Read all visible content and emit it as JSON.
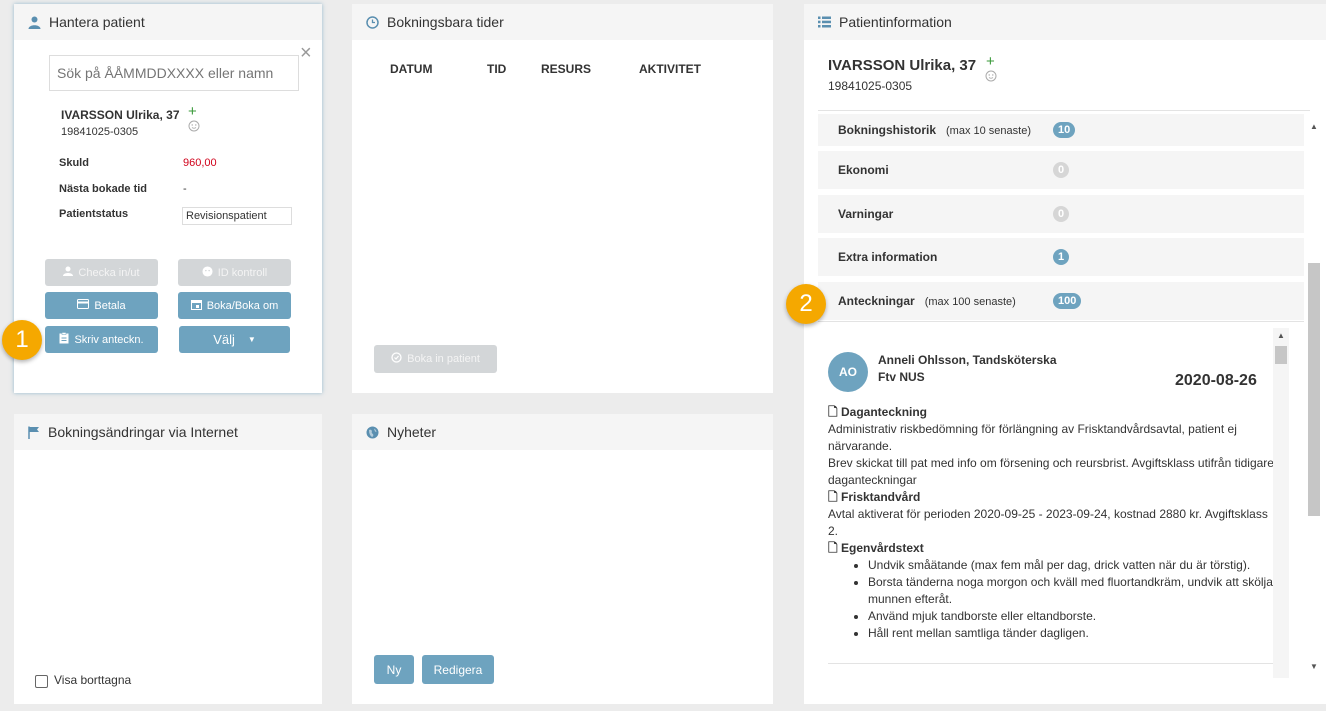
{
  "hantera": {
    "title": "Hantera patient",
    "search_placeholder": "Sök på ÅÅMMDDXXXX eller namn",
    "patient_name": "IVARSSON Ulrika, 37",
    "patient_id": "19841025-0305",
    "fields": [
      {
        "label": "Skuld",
        "value": "960,00"
      },
      {
        "label": "Nästa bokade tid",
        "value": "-"
      },
      {
        "label": "Patientstatus",
        "value": "Revisionspatient"
      }
    ],
    "buttons": {
      "checka": "Checka in/ut",
      "id_kontroll": "ID kontroll",
      "betala": "Betala",
      "boka": "Boka/Boka om",
      "skriv": "Skriv anteckn.",
      "valj": "Välj"
    }
  },
  "bokningsbara": {
    "title": "Bokningsbara tider",
    "columns": [
      "DATUM",
      "TID",
      "RESURS",
      "AKTIVITET"
    ],
    "boka_in_label": "Boka in patient"
  },
  "internet": {
    "title": "Bokningsändringar via Internet",
    "visa_borttagna": "Visa borttagna"
  },
  "nyheter": {
    "title": "Nyheter",
    "ny": "Ny",
    "redigera": "Redigera"
  },
  "patientinfo": {
    "title": "Patientinformation",
    "patient_name": "IVARSSON Ulrika, 37",
    "patient_id": "19841025-0305",
    "rows": [
      {
        "label": "Bokningshistorik",
        "sub": "(max 10 senaste)",
        "count": "10"
      },
      {
        "label": "Ekonomi",
        "sub": "",
        "count": "0"
      },
      {
        "label": "Varningar",
        "sub": "",
        "count": "0"
      },
      {
        "label": "Extra information",
        "sub": "",
        "count": "1"
      },
      {
        "label": "Anteckningar",
        "sub": "(max 100 senaste)",
        "count": "100"
      }
    ],
    "note": {
      "initials": "AO",
      "author": "Anneli Ohlsson, Tandsköterska",
      "clinic": "Ftv NUS",
      "date": "2020-08-26",
      "sections": {
        "s1_title": "Daganteckning",
        "s1_p1": "Administrativ riskbedömning för förlängning av Frisktandvårdsavtal, patient ej närvarande.",
        "s1_p2": "Brev skickat till pat med info om försening och reursbrist. Avgiftsklass utifrån tidigare daganteckningar",
        "s2_title": "Frisktandvård",
        "s2_p1": "Avtal aktiverat för perioden 2020-09-25 - 2023-09-24, kostnad 2880 kr. Avgiftsklass 2.",
        "s3_title": "Egenvårdstext",
        "bullets": [
          "Undvik småätande (max fem mål per dag, drick vatten när du är törstig).",
          "Borsta tänderna noga morgon och kväll med fluortandkräm, undvik att skölja munnen efteråt.",
          "Använd mjuk tandborste eller eltandborste.",
          "Håll rent mellan samtliga tänder dagligen."
        ]
      }
    }
  },
  "callouts": [
    "1",
    "2"
  ],
  "colors": {
    "accent": "#6ea3bf",
    "debt": "#d0021b",
    "callout": "#f5a800",
    "plus": "#3a9a3a"
  }
}
